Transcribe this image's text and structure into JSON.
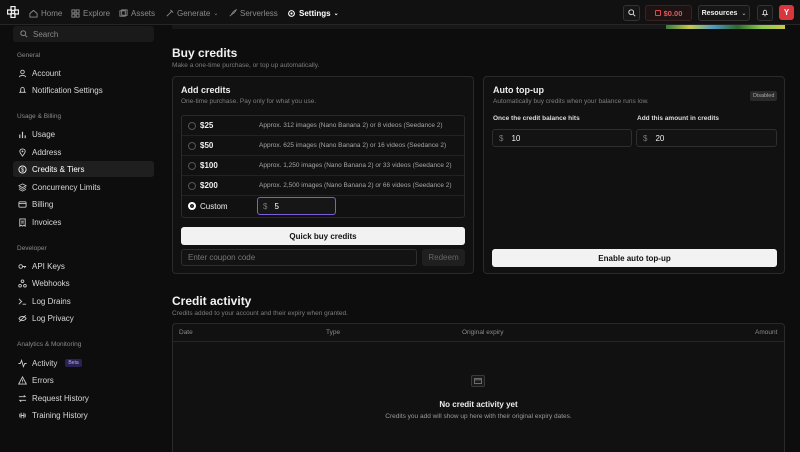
{
  "nav": {
    "home": "Home",
    "explore": "Explore",
    "assets": "Assets",
    "generate": "Generate",
    "serverless": "Serverless",
    "settings": "Settings",
    "balance": "$0.00",
    "resources": "Resources",
    "avatar_initial": "Y"
  },
  "sidebar": {
    "search_placeholder": "Search",
    "general_title": "General",
    "account": "Account",
    "notification_settings": "Notification Settings",
    "usage_title": "Usage & Billing",
    "usage": "Usage",
    "address": "Address",
    "credits_tiers": "Credits & Tiers",
    "concurrency_limits": "Concurrency Limits",
    "billing": "Billing",
    "invoices": "Invoices",
    "developer_title": "Developer",
    "api_keys": "API Keys",
    "webhooks": "Webhooks",
    "log_drains": "Log Drains",
    "log_privacy": "Log Privacy",
    "analytics_title": "Analytics & Monitoring",
    "activity": "Activity",
    "activity_badge": "Beta",
    "errors": "Errors",
    "request_history": "Request History",
    "training_history": "Training History"
  },
  "buy_credits": {
    "title": "Buy credits",
    "subtitle": "Make a one-time purchase, or top up automatically."
  },
  "add_credits": {
    "title": "Add credits",
    "subtitle": "One-time purchase. Pay only for what you use.",
    "options": [
      {
        "amount": "$25",
        "desc": "Approx. 312 images (Nano Banana 2) or 8 videos (Seedance 2)"
      },
      {
        "amount": "$50",
        "desc": "Approx. 625 images (Nano Banana 2) or 16 videos (Seedance 2)"
      },
      {
        "amount": "$100",
        "desc": "Approx. 1,250 images (Nano Banana 2) or 33 videos (Seedance 2)"
      },
      {
        "amount": "$200",
        "desc": "Approx. 2,500 images (Nano Banana 2) or 66 videos (Seedance 2)"
      }
    ],
    "custom_label": "Custom",
    "currency_symbol": "$",
    "custom_value": "5",
    "quick_buy": "Quick buy credits",
    "coupon_placeholder": "Enter coupon code",
    "redeem": "Redeem"
  },
  "auto_topup": {
    "title": "Auto top-up",
    "subtitle": "Automatically buy credits when your balance runs low.",
    "status": "Disabled",
    "threshold_label": "Once the credit balance hits",
    "threshold_value": "10",
    "amount_label": "Add this amount in credits",
    "amount_value": "20",
    "currency_symbol": "$",
    "enable": "Enable auto top-up"
  },
  "activity": {
    "title": "Credit activity",
    "subtitle": "Credits added to your account and their expiry when granted.",
    "columns": [
      "Date",
      "Type",
      "Original expiry",
      "Amount"
    ],
    "empty_title": "No credit activity yet",
    "empty_subtitle": "Credits you add will show up here with their original expiry dates."
  }
}
